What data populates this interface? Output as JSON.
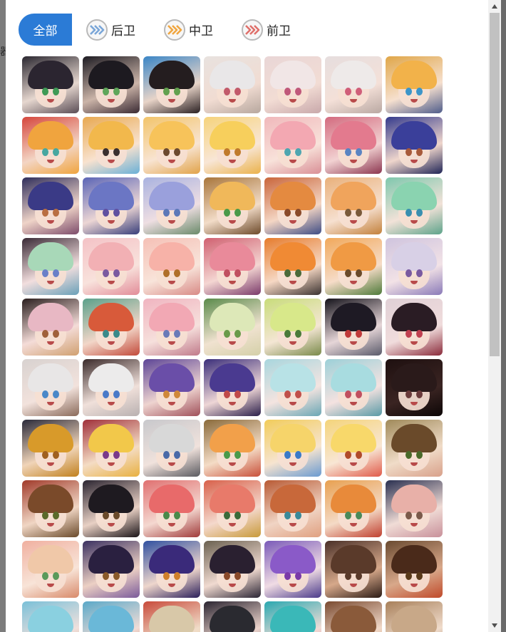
{
  "background": {
    "edge_text": "器"
  },
  "tabs": [
    {
      "label": "全部",
      "active": true
    },
    {
      "label": "后卫",
      "icon": "chevrons-blue-icon",
      "color": "#7aa6d8"
    },
    {
      "label": "中卫",
      "icon": "chevrons-orange-icon",
      "color": "#f0a640"
    },
    {
      "label": "前卫",
      "icon": "chevrons-red-icon",
      "color": "#e0706a"
    }
  ],
  "characters": [
    {
      "hair": "#2b2530",
      "eye": "#3f9a56",
      "c1": "#2a2730",
      "c2": "#e6d7cf",
      "c3": "#5a4d55"
    },
    {
      "hair": "#1d1a20",
      "eye": "#5fa65a",
      "c1": "#1d1b22",
      "c2": "#cbb4a8",
      "c3": "#3a2a33"
    },
    {
      "hair": "#241d1f",
      "eye": "#63a14f",
      "c1": "#3a85c6",
      "c2": "#e8d4c8",
      "c3": "#2a2022"
    },
    {
      "hair": "#e9e7e8",
      "eye": "#c25a6a",
      "c1": "#e8e2df",
      "c2": "#f1dcd2",
      "c3": "#b7a79e"
    },
    {
      "hair": "#f1e6e6",
      "eye": "#c0587a",
      "c1": "#e9d6d6",
      "c2": "#f2dcd4",
      "c3": "#c8a8aa"
    },
    {
      "hair": "#eeeae9",
      "eye": "#d05e79",
      "c1": "#e6dede",
      "c2": "#f4e0d8",
      "c3": "#b9a8a2"
    },
    {
      "hair": "#f2b24a",
      "eye": "#3d95c9",
      "c1": "#e0a648",
      "c2": "#f6e0cf",
      "c3": "#4e5c8a"
    },
    {
      "hair": "#f0a43e",
      "eye": "#47a7a0",
      "c1": "#d5473d",
      "c2": "#f3d5c4",
      "c3": "#f0a43e"
    },
    {
      "hair": "#f2b84c",
      "eye": "#3a3030",
      "c1": "#e8a850",
      "c2": "#f8e2cf",
      "c3": "#6bb0d6"
    },
    {
      "hair": "#f7c35a",
      "eye": "#6b4a30",
      "c1": "#f2c46a",
      "c2": "#f8e4d2",
      "c3": "#e1a34a"
    },
    {
      "hair": "#f7cf5c",
      "eye": "#c07a2c",
      "c1": "#f6d37b",
      "c2": "#f8e6d6",
      "c3": "#eab24c"
    },
    {
      "hair": "#f3a8b2",
      "eye": "#4ea6b0",
      "c1": "#f0b8bb",
      "c2": "#f8e2da",
      "c3": "#d98f96"
    },
    {
      "hair": "#e37a8e",
      "eye": "#5a84c2",
      "c1": "#d36a7e",
      "c2": "#f2d2d2",
      "c3": "#8c3650"
    },
    {
      "hair": "#3a3f9a",
      "eye": "#a85a3a",
      "c1": "#343a8c",
      "c2": "#efd6cc",
      "c3": "#1f2456"
    },
    {
      "hair": "#3a3a86",
      "eye": "#b96f42",
      "c1": "#2e2d5a",
      "c2": "#efd4c8",
      "c3": "#7c4b6a"
    },
    {
      "hair": "#6b76c4",
      "eye": "#6050a0",
      "c1": "#5a64b6",
      "c2": "#ecd6d4",
      "c3": "#383e7a"
    },
    {
      "hair": "#9aa0dc",
      "eye": "#5c78b8",
      "c1": "#a9b2e0",
      "c2": "#eedee2",
      "c3": "#6a8a6a"
    },
    {
      "hair": "#f0b85a",
      "eye": "#4a9a4a",
      "c1": "#a8753a",
      "c2": "#f2dcc8",
      "c3": "#6d4a2a"
    },
    {
      "hair": "#e48a40",
      "eye": "#8a4a2a",
      "c1": "#c9653a",
      "c2": "#f4d6c4",
      "c3": "#3e4c84"
    },
    {
      "hair": "#f0a45c",
      "eye": "#7a5a3a",
      "c1": "#e9b07a",
      "c2": "#f6e0d0",
      "c3": "#c3813c"
    },
    {
      "hair": "#8ad3b0",
      "eye": "#3a8fb0",
      "c1": "#7ec7ad",
      "c2": "#f2e2d8",
      "c3": "#5da38a"
    },
    {
      "hair": "#a8d8b8",
      "eye": "#6a80c8",
      "c1": "#3a2a36",
      "c2": "#f2dede",
      "c3": "#6aa0b8"
    },
    {
      "hair": "#f2b0b4",
      "eye": "#7a5aa0",
      "c1": "#f4c2c6",
      "c2": "#f8e2dc",
      "c3": "#e28c98"
    },
    {
      "hair": "#f7b2a8",
      "eye": "#b0702a",
      "c1": "#f5c0b6",
      "c2": "#f8e4da",
      "c3": "#d88a86"
    },
    {
      "hair": "#e98a9a",
      "eye": "#c05060",
      "c1": "#d06070",
      "c2": "#f4d6d2",
      "c3": "#7a3a6a"
    },
    {
      "hair": "#f08a34",
      "eye": "#4a6a3a",
      "c1": "#e67b2c",
      "c2": "#f6d8c4",
      "c3": "#3a3230"
    },
    {
      "hair": "#f09a44",
      "eye": "#6a4a2a",
      "c1": "#f1a85a",
      "c2": "#f6dcc8",
      "c3": "#4e7a3a"
    },
    {
      "hair": "#d8d0e6",
      "eye": "#7a5aa0",
      "c1": "#cfc4de",
      "c2": "#f2e2e6",
      "c3": "#8a7ab8"
    },
    {
      "hair": "#e8b8c4",
      "eye": "#a0603a",
      "c1": "#2a1e1e",
      "c2": "#f4dcd8",
      "c3": "#d0a070"
    },
    {
      "hair": "#d85a3a",
      "eye": "#3a8a8a",
      "c1": "#5aa08a",
      "c2": "#f2d6c8",
      "c3": "#c24a3a"
    },
    {
      "hair": "#f2a8b4",
      "eye": "#6a7ab8",
      "c1": "#f0b4c0",
      "c2": "#f6e0dc",
      "c3": "#c07a8a"
    },
    {
      "hair": "#dde8b8",
      "eye": "#6a9a4a",
      "c1": "#5a8a4a",
      "c2": "#f0e2d0",
      "c3": "#d4d0a8"
    },
    {
      "hair": "#d8e88a",
      "eye": "#4a7a3a",
      "c1": "#c8dc7a",
      "c2": "#f4e6d4",
      "c3": "#7a8a4a"
    },
    {
      "hair": "#1e1a24",
      "eye": "#c03a3a",
      "c1": "#14121a",
      "c2": "#e6d6d8",
      "c3": "#5a5a6a"
    },
    {
      "hair": "#2a1c24",
      "eye": "#c04050",
      "c1": "#e0d0d6",
      "c2": "#f0dcdc",
      "c3": "#8a2a3a"
    },
    {
      "hair": "#e8e6e6",
      "eye": "#4a88c8",
      "c1": "#d8d2d0",
      "c2": "#f2e2dc",
      "c3": "#8a6a5a"
    },
    {
      "hair": "#ecebeb",
      "eye": "#4a7ac8",
      "c1": "#3a2a2a",
      "c2": "#f0e0da",
      "c3": "#b8b0b0"
    },
    {
      "hair": "#6a4ea8",
      "eye": "#d0883a",
      "c1": "#5c4496",
      "c2": "#eed4d0",
      "c3": "#a0505a"
    },
    {
      "hair": "#4a3a90",
      "eye": "#c04a4a",
      "c1": "#3a2e7a",
      "c2": "#eed6d6",
      "c3": "#2a1e4a"
    },
    {
      "hair": "#b8e2e6",
      "eye": "#c0504a",
      "c1": "#a8d6de",
      "c2": "#f4e4e0",
      "c3": "#6aa6b4"
    },
    {
      "hair": "#a8dce0",
      "eye": "#c05060",
      "c1": "#9cd0d8",
      "c2": "#f4e2e0",
      "c3": "#5a9aa6"
    },
    {
      "hair": "#2a1a1a",
      "eye": "#6a3a3a",
      "c1": "#1e1010",
      "c2": "#3a2422",
      "c3": "#0c0606"
    },
    {
      "hair": "#d89a2a",
      "eye": "#a06020",
      "c1": "#2a2a3a",
      "c2": "#f0d4b8",
      "c3": "#c0801e"
    },
    {
      "hair": "#f2c84a",
      "eye": "#7a3a8a",
      "c1": "#a0303a",
      "c2": "#f4dcc4",
      "c3": "#e8b040"
    },
    {
      "hair": "#d8d8d8",
      "eye": "#4a6aa8",
      "c1": "#c8c8cc",
      "c2": "#f0e2dc",
      "c3": "#5a5a60"
    },
    {
      "hair": "#f2a04a",
      "eye": "#4a9a4a",
      "c1": "#8a6a3a",
      "c2": "#f4dcc6",
      "c3": "#c8503a"
    },
    {
      "hair": "#f6d46a",
      "eye": "#3a7ac8",
      "c1": "#f2cc5a",
      "c2": "#f6e4d0",
      "c3": "#6a9ad0"
    },
    {
      "hair": "#f8d86a",
      "eye": "#b04a2a",
      "c1": "#f4d47a",
      "c2": "#f8e6d4",
      "c3": "#e05a4a"
    },
    {
      "hair": "#6a4a2a",
      "eye": "#4a6a2a",
      "c1": "#a08a5a",
      "c2": "#f0dcc8",
      "c3": "#d8a08a"
    },
    {
      "hair": "#7a4a2a",
      "eye": "#5a6a2a",
      "c1": "#a03a2a",
      "c2": "#f0d6c4",
      "c3": "#6a4a2a"
    },
    {
      "hair": "#1e1a20",
      "eye": "#6a4a2a",
      "c1": "#2a2430",
      "c2": "#e8d0c4",
      "c3": "#1a1418"
    },
    {
      "hair": "#e86a6a",
      "eye": "#4a8a4a",
      "c1": "#e07070",
      "c2": "#f4d8d0",
      "c3": "#a03a3a"
    },
    {
      "hair": "#e87a6a",
      "eye": "#3a6a3a",
      "c1": "#d8604a",
      "c2": "#f4d8cc",
      "c3": "#c89a3a"
    },
    {
      "hair": "#c8683a",
      "eye": "#3a8a9a",
      "c1": "#b85a34",
      "c2": "#f0d4c4",
      "c3": "#e0a080"
    },
    {
      "hair": "#e88a3a",
      "eye": "#4a8a5a",
      "c1": "#e8a050",
      "c2": "#f4dac6",
      "c3": "#c04030"
    },
    {
      "hair": "#e8b0a8",
      "eye": "#7a5a4a",
      "c1": "#2a3050",
      "c2": "#f0dcd6",
      "c3": "#c8909a"
    },
    {
      "hair": "#f0c8a8",
      "eye": "#5a9a5a",
      "c1": "#f0b0a0",
      "c2": "#f8e4d8",
      "c3": "#d88a6a"
    },
    {
      "hair": "#2a2040",
      "eye": "#8a5a2a",
      "c1": "#3a3060",
      "c2": "#ecd0c4",
      "c3": "#7a5a9a"
    },
    {
      "hair": "#3a2a7a",
      "eye": "#d0802a",
      "c1": "#3050a0",
      "c2": "#eed6cc",
      "c3": "#2a1e5a"
    },
    {
      "hair": "#2a2030",
      "eye": "#8a4a2a",
      "c1": "#6a6050",
      "c2": "#f0dad0",
      "c3": "#2a2434"
    },
    {
      "hair": "#8a5ac8",
      "eye": "#7a3aa8",
      "c1": "#7a5ab8",
      "c2": "#f0dce4",
      "c3": "#4a3a8a"
    },
    {
      "hair": "#5a3a2a",
      "eye": "#5a3a2a",
      "c1": "#4a3028",
      "c2": "#d6a88a",
      "c3": "#2a1a14"
    },
    {
      "hair": "#4a2a1a",
      "eye": "#5a3a1a",
      "c1": "#6a4a30",
      "c2": "#d8a88a",
      "c3": "#c04a2a"
    },
    {
      "hair": "#8ad0e0",
      "eye": "#3a8aa8",
      "c1": "#7ac0d8",
      "c2": "#f0e0dc",
      "c3": "#d0a07a"
    },
    {
      "hair": "#6ab8d8",
      "eye": "#3a7aa8",
      "c1": "#5aa8c8",
      "c2": "#f0dcd6",
      "c3": "#c8603a"
    },
    {
      "hair": "#d8c8a8",
      "eye": "#7a5a3a",
      "c1": "#c84a3a",
      "c2": "#f0dcc8",
      "c3": "#e8d0a8"
    },
    {
      "hair": "#2a2a30",
      "eye": "#5a3a3a",
      "c1": "#2a2430",
      "c2": "#ecd4cc",
      "c3": "#5a5060"
    },
    {
      "hair": "#3ab8b8",
      "eye": "#3a6aa8",
      "c1": "#2aa8b0",
      "c2": "#f0dcd6",
      "c3": "#e06a80"
    },
    {
      "hair": "#8a5a3a",
      "eye": "#5a4a2a",
      "c1": "#7a4a30",
      "c2": "#f0d8c8",
      "c3": "#c08a5a"
    },
    {
      "hair": "#c8a888",
      "eye": "#7a5a3a",
      "c1": "#a8805a",
      "c2": "#f0dccc",
      "c3": "#8a6a4a"
    }
  ],
  "scrollbar": {
    "up_icon": "scroll-up-arrow-icon",
    "down_icon": "scroll-down-arrow-icon"
  }
}
